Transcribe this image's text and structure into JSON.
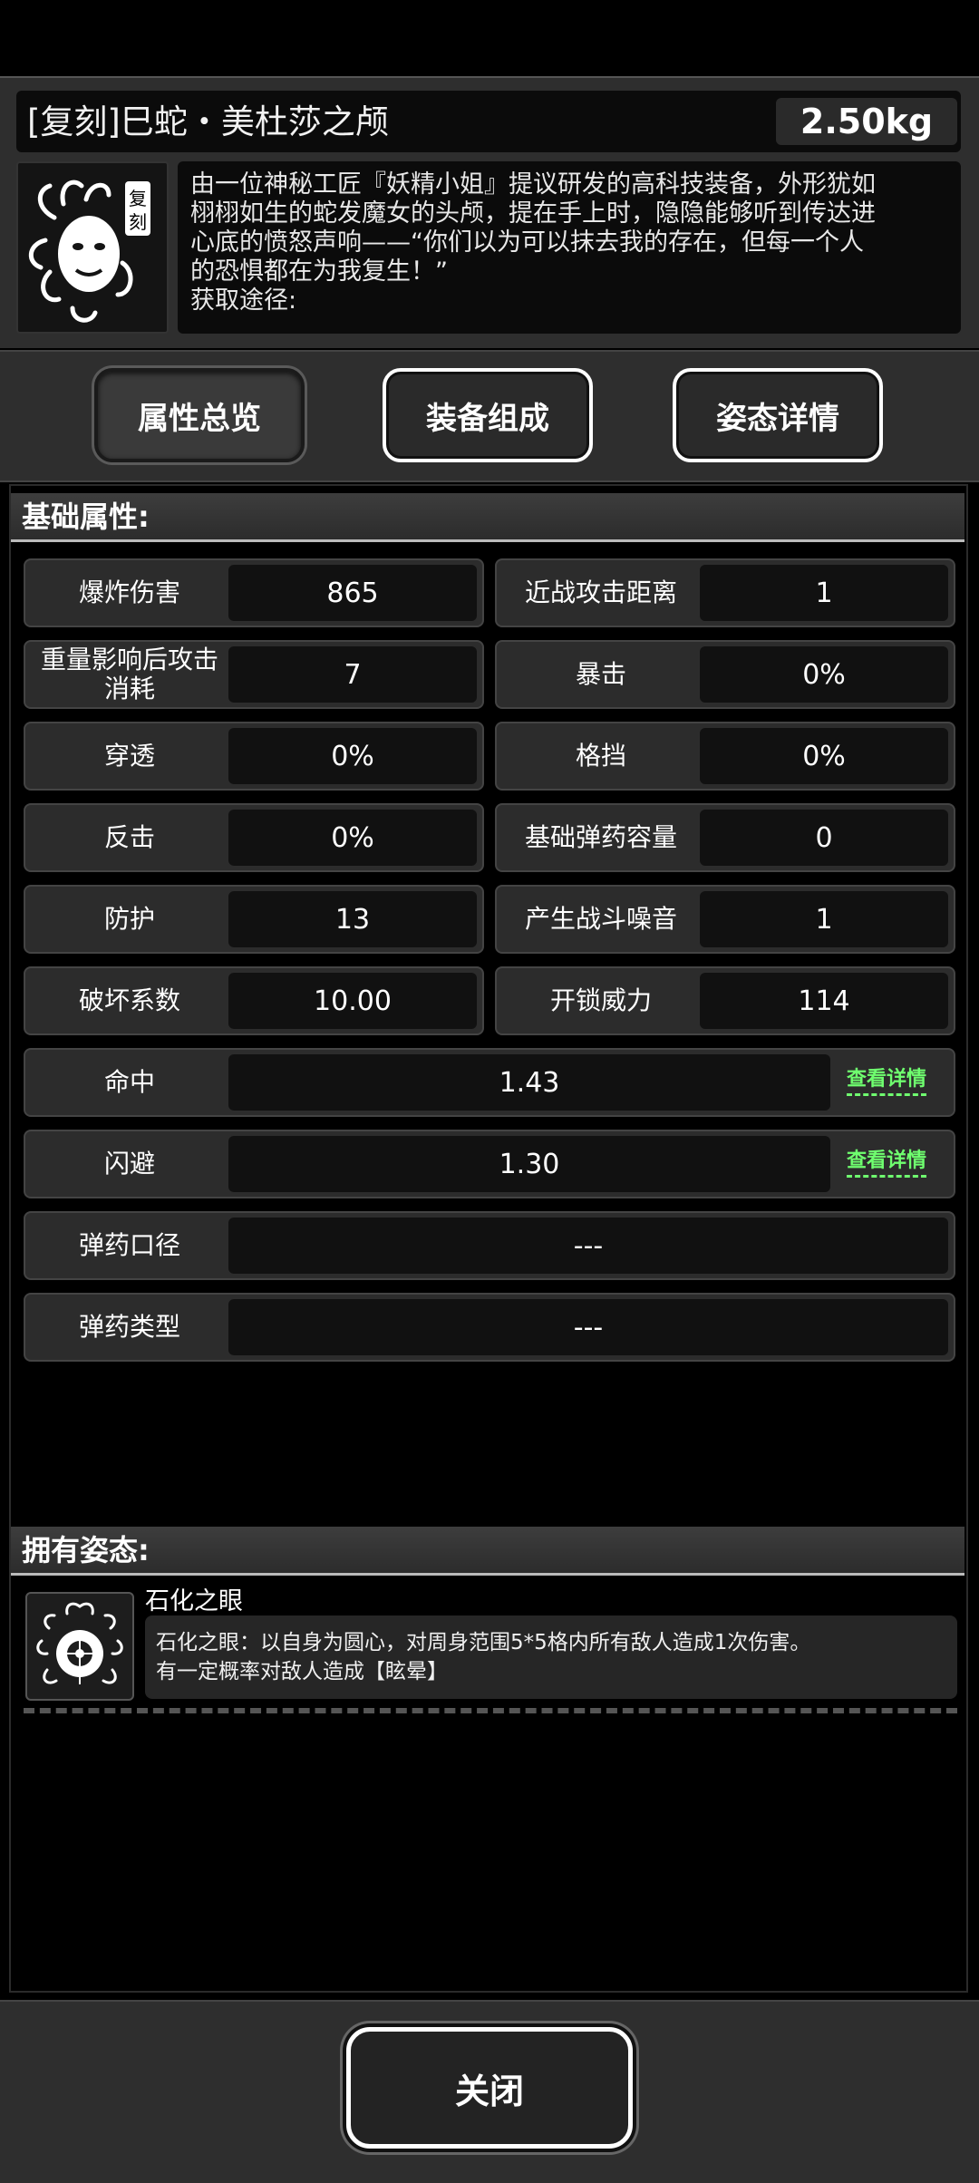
{
  "item": {
    "title": "[复刻]巳蛇・美杜莎之颅",
    "weight": "2.50kg",
    "icon": "medusa-head-icon",
    "icon_badge": "复刻",
    "description_lines": [
      "由一位神秘工匠『妖精小姐』提议研发的高科技装备，外形犹如",
      "栩栩如生的蛇发魔女的头颅，提在手上时，隐隐能够听到传达进",
      "心底的愤怒声响——“你们以为可以抹去我的存在，但每一个人",
      "的恐惧都在为我复生！”",
      "获取途径:"
    ]
  },
  "tabs": [
    {
      "label": "属性总览",
      "active": true
    },
    {
      "label": "装备组成",
      "active": false
    },
    {
      "label": "姿态详情",
      "active": false
    }
  ],
  "basic": {
    "header": "基础属性:",
    "pairs": [
      [
        {
          "label": "爆炸伤害",
          "value": "865"
        },
        {
          "label": "近战攻击距离",
          "value": "1"
        }
      ],
      [
        {
          "label": "重量影响后攻击消耗",
          "value": "7"
        },
        {
          "label": "暴击",
          "value": "0%"
        }
      ],
      [
        {
          "label": "穿透",
          "value": "0%"
        },
        {
          "label": "格挡",
          "value": "0%"
        }
      ],
      [
        {
          "label": "反击",
          "value": "0%"
        },
        {
          "label": "基础弹药容量",
          "value": "0"
        }
      ],
      [
        {
          "label": "防护",
          "value": "13"
        },
        {
          "label": "产生战斗噪音",
          "value": "1"
        }
      ],
      [
        {
          "label": "破坏系数",
          "value": "10.00"
        },
        {
          "label": "开锁威力",
          "value": "114"
        }
      ]
    ],
    "wide": [
      {
        "label": "命中",
        "value": "1.43",
        "link": "查看详情"
      },
      {
        "label": "闪避",
        "value": "1.30",
        "link": "查看详情"
      },
      {
        "label": "弹药口径",
        "value": "---"
      },
      {
        "label": "弹药类型",
        "value": "---"
      }
    ]
  },
  "stances": {
    "header": "拥有姿态:",
    "items": [
      {
        "name": "石化之眼",
        "icon": "medusa-eye-icon",
        "desc_lines": [
          "石化之眼：以自身为圆心，对周身范围5*5格内所有敌人造成1次伤害。",
          "有一定概率对敌人造成【眩晕】"
        ]
      }
    ]
  },
  "close_label": "关闭"
}
